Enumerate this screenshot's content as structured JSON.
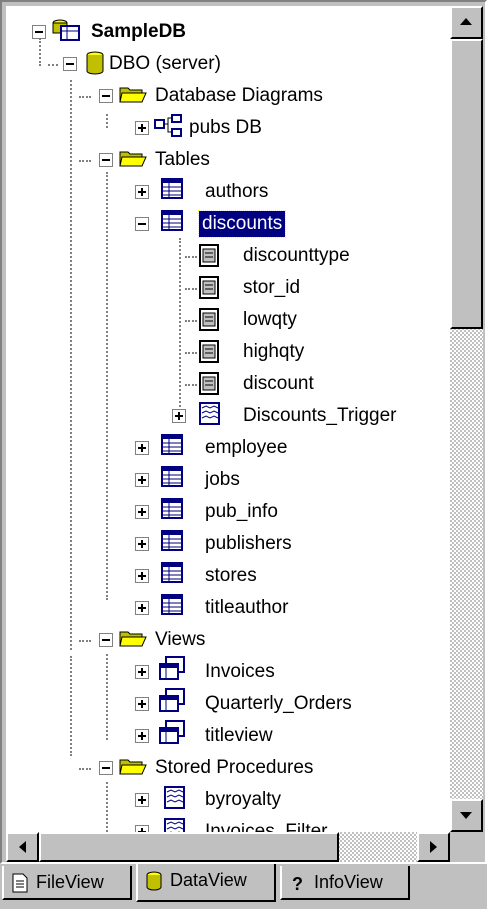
{
  "tree": {
    "root": "SampleDB",
    "server": "DBO (server)",
    "folders": {
      "diagrams": "Database Diagrams",
      "tables": "Tables",
      "views": "Views",
      "procedures": "Stored Procedures"
    },
    "diagram_items": [
      "pubs DB"
    ],
    "tables": {
      "authors": "authors",
      "discounts": "discounts",
      "columns": [
        "discounttype",
        "stor_id",
        "lowqty",
        "highqty",
        "discount"
      ],
      "trigger": "Discounts_Trigger",
      "rest": [
        "employee",
        "jobs",
        "pub_info",
        "publishers",
        "stores",
        "titleauthor"
      ]
    },
    "views": [
      "Invoices",
      "Quarterly_Orders",
      "titleview"
    ],
    "procedures": [
      "byroyalty",
      "Invoices_Filter"
    ]
  },
  "tabs": [
    "FileView",
    "DataView",
    "InfoView"
  ],
  "selected": "discounts",
  "scroll": {
    "vertical_position": 0.0,
    "vertical_visible_fraction": 0.38
  },
  "colors": {
    "selection": "#000080",
    "folder": "#ffff00",
    "table_blue": "#000080"
  }
}
